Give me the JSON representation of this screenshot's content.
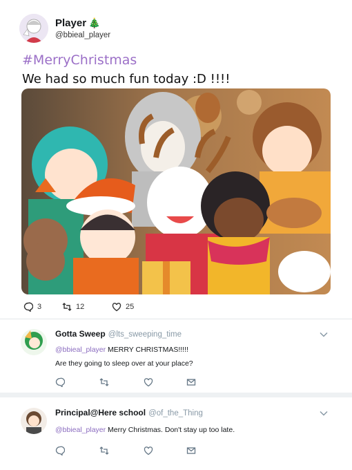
{
  "tweet": {
    "author": "Player",
    "handle": "@bbieal_player",
    "hashtag": "#MerryChristmas",
    "text": "We had so much fun today :D !!!!",
    "stats": {
      "replies": "3",
      "retweets": "12",
      "likes": "25"
    }
  },
  "replies": [
    {
      "name": "Gotta Sweep",
      "handle": "@lts_sweeping_time",
      "mention": "@bbieal_player",
      "line1_rest": " MERRY CHRISTMAS!!!!!",
      "line2": "Are they going to sleep over at your place?"
    },
    {
      "name": "Principal@Here school",
      "handle": "@of_the_Thing",
      "mention": "@bbieal_player",
      "line1_rest": " Merry Christmas. Don't stay up too late.",
      "line2": ""
    }
  ],
  "colors": {
    "accent_purple": "#9b6fc7",
    "muted": "#8899a6",
    "icon": "#657786"
  },
  "icons": [
    "tree-icon",
    "reply-icon",
    "retweet-icon",
    "like-icon",
    "message-icon",
    "chevron-down-icon"
  ]
}
